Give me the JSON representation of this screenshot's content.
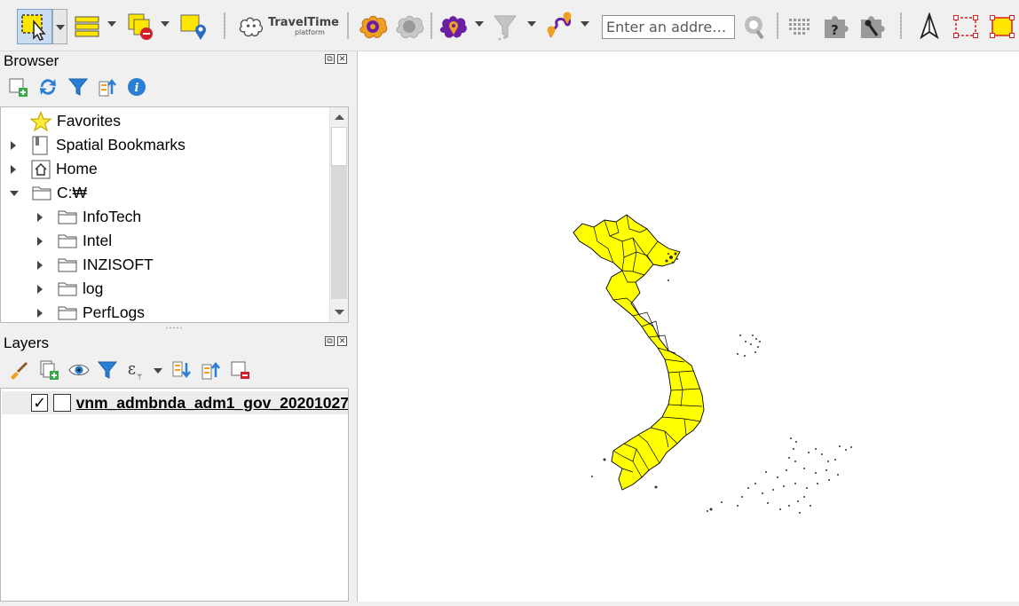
{
  "toolbar": {
    "address_placeholder": "Enter an addre…",
    "traveltime_logo": "TravelTime",
    "traveltime_sub": "platform",
    "icons": [
      "select-features-icon",
      "attribute-table-icon",
      "deselect-icon",
      "select-by-location-icon",
      "traveltime-logo",
      "traveltime-settings-icon",
      "traveltime-gray-icon",
      "isochrone-icon",
      "filter-icon",
      "route-icon",
      "geocode-icon",
      "grid-icon",
      "help-puzzle-icon",
      "tools-icon",
      "north-arrow-icon",
      "bounding-box-icon",
      "fill-box-icon"
    ]
  },
  "browser": {
    "title": "Browser",
    "items": [
      {
        "label": "Favorites",
        "icon": "star-icon",
        "expand": "none",
        "indent": 0
      },
      {
        "label": "Spatial Bookmarks",
        "icon": "bookmark-icon",
        "expand": "collapsed",
        "indent": 0
      },
      {
        "label": "Home",
        "icon": "home-icon",
        "expand": "collapsed",
        "indent": 0
      },
      {
        "label": "C:₩",
        "icon": "folder-icon",
        "expand": "expanded",
        "indent": 0
      },
      {
        "label": "InfoTech",
        "icon": "folder-icon",
        "expand": "collapsed",
        "indent": 1
      },
      {
        "label": "Intel",
        "icon": "folder-icon",
        "expand": "collapsed",
        "indent": 1
      },
      {
        "label": "INZISOFT",
        "icon": "folder-icon",
        "expand": "collapsed",
        "indent": 1
      },
      {
        "label": "log",
        "icon": "folder-icon",
        "expand": "collapsed",
        "indent": 1
      },
      {
        "label": "PerfLogs",
        "icon": "folder-icon",
        "expand": "collapsed",
        "indent": 1
      }
    ]
  },
  "layers": {
    "title": "Layers",
    "items": [
      {
        "name": "vnm_admbnda_adm1_gov_20201027",
        "checked": true
      }
    ]
  },
  "map": {
    "fill_color": "#ffff00",
    "stroke_color": "#000000"
  },
  "colors": {
    "toolbar_bg": "#f0f0f0",
    "selected_tool": "#c9dcf1",
    "polygon_fill": "#ffff00",
    "plugin_orange": "#f0a020",
    "plugin_purple": "#6a1fa3"
  }
}
